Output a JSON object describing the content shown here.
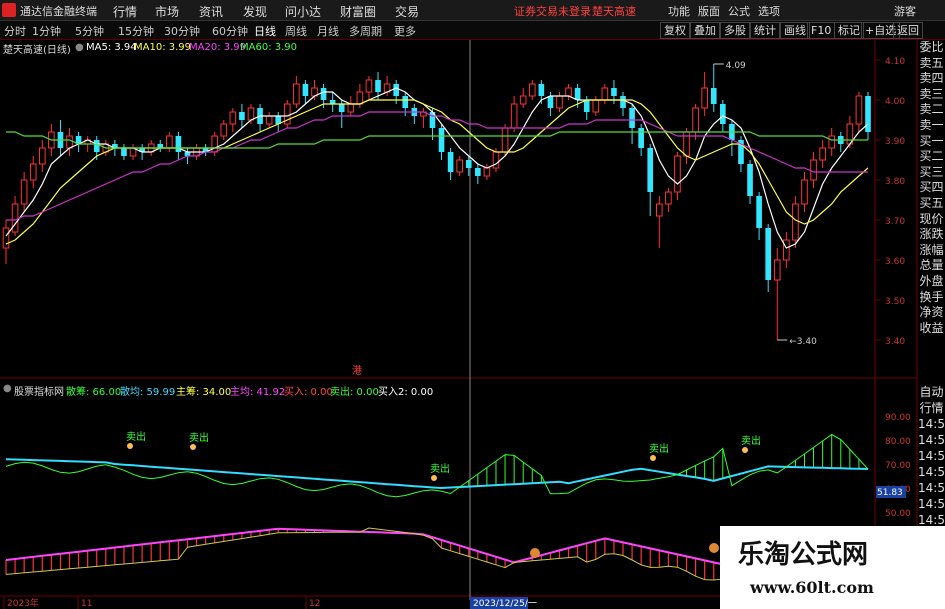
{
  "topbar": {
    "brand": "通达信金融终端",
    "menus": [
      "行情",
      "市场",
      "资讯",
      "发现",
      "问小达",
      "财富圈",
      "交易"
    ],
    "alert": "证券交易未登录",
    "alert2": "楚天高速",
    "right": [
      "功能",
      "版面",
      "公式",
      "选项"
    ],
    "guest": "游客"
  },
  "toolbar": {
    "timeframes": [
      "分时",
      "1分钟",
      "5分钟",
      "15分钟",
      "30分钟",
      "60分钟",
      "日线",
      "周线",
      "月线",
      "多周期",
      "更多"
    ],
    "right": [
      "复权",
      "叠加",
      "多股",
      "统计",
      "画线",
      "F10",
      "标记",
      "+自选",
      "返回"
    ]
  },
  "header": {
    "stock": "楚天高速(日线)",
    "ma5": "MA5: 3.94",
    "ma10": "MA10: 3.99",
    "ma20": "MA20: 3.99",
    "ma60": "MA60: 3.90"
  },
  "indicator": {
    "name": "股票指标网",
    "items": [
      {
        "text": "散筹: 66.00",
        "color": "#33ff33"
      },
      {
        "text": "散均: 59.99",
        "color": "#33ddff"
      },
      {
        "text": "主筹: 34.00",
        "color": "#ffff44"
      },
      {
        "text": "主均: 41.92",
        "color": "#ff44ff"
      },
      {
        "text": "买入: 0.00",
        "color": "#ff4444"
      },
      {
        "text": "卖出: 0.00",
        "color": "#33ff33"
      },
      {
        "text": "买入2: 0.00",
        "color": "#ffffff"
      }
    ]
  },
  "side_panel": [
    "委比",
    "卖五",
    "卖四",
    "卖三",
    "卖二",
    "卖一",
    "买一",
    "买二",
    "买三",
    "买四",
    "买五",
    "现价",
    "涨跌",
    "涨幅",
    "总量",
    "外盘",
    "换手",
    "净资",
    "收益"
  ],
  "side_panel2": [
    "自动",
    "行情",
    "14:50",
    "14:50",
    "14:50",
    "14:50",
    "14:50",
    "14:50",
    "14:50",
    "14:50",
    "14:50",
    "14:50",
    "14:50",
    "14:50"
  ],
  "bottom_axis": {
    "labels": [
      "2023年",
      "11",
      "12",
      "2023/12/25/一"
    ]
  },
  "annotations": {
    "sell": "卖出",
    "hk": "港",
    "hi": "4.09",
    "lo": "3.40",
    "cursor_value": "51.83"
  },
  "watermark": {
    "line1": "乐淘公式网",
    "line2": "www.60lt.com"
  },
  "chart_data": [
    {
      "type": "candlestick",
      "title": "楚天高速(日线)",
      "ylim": [
        3.36,
        4.13
      ],
      "y_ticks": [
        "4.10",
        "4.00",
        "3.90",
        "3.80",
        "3.70",
        "3.60",
        "3.50",
        "3.40"
      ],
      "high_label": 4.09,
      "low_label": 3.4,
      "candles": [
        [
          3.63,
          3.68,
          3.59,
          3.7
        ],
        [
          3.67,
          3.74,
          3.66,
          3.76
        ],
        [
          3.74,
          3.8,
          3.72,
          3.82
        ],
        [
          3.8,
          3.84,
          3.78,
          3.86
        ],
        [
          3.84,
          3.88,
          3.82,
          3.9
        ],
        [
          3.88,
          3.92,
          3.86,
          3.94
        ],
        [
          3.92,
          3.88,
          3.86,
          3.95
        ],
        [
          3.88,
          3.91,
          3.86,
          3.93
        ],
        [
          3.91,
          3.89,
          3.87,
          3.92
        ],
        [
          3.89,
          3.9,
          3.87,
          3.91
        ],
        [
          3.9,
          3.87,
          3.85,
          3.91
        ],
        [
          3.87,
          3.89,
          3.86,
          3.9
        ],
        [
          3.89,
          3.88,
          3.86,
          3.9
        ],
        [
          3.88,
          3.86,
          3.85,
          3.89
        ],
        [
          3.86,
          3.88,
          3.85,
          3.89
        ],
        [
          3.88,
          3.87,
          3.85,
          3.89
        ],
        [
          3.87,
          3.89,
          3.86,
          3.9
        ],
        [
          3.89,
          3.88,
          3.87,
          3.9
        ],
        [
          3.88,
          3.91,
          3.87,
          3.92
        ],
        [
          3.91,
          3.87,
          3.85,
          3.92
        ],
        [
          3.87,
          3.86,
          3.84,
          3.88
        ],
        [
          3.86,
          3.88,
          3.85,
          3.89
        ],
        [
          3.88,
          3.87,
          3.86,
          3.89
        ],
        [
          3.87,
          3.91,
          3.86,
          3.92
        ],
        [
          3.91,
          3.94,
          3.9,
          3.95
        ],
        [
          3.94,
          3.97,
          3.92,
          3.98
        ],
        [
          3.97,
          3.95,
          3.93,
          3.99
        ],
        [
          3.95,
          3.98,
          3.94,
          3.99
        ],
        [
          3.98,
          3.94,
          3.92,
          3.99
        ],
        [
          3.94,
          3.96,
          3.93,
          3.97
        ],
        [
          3.96,
          3.94,
          3.92,
          3.97
        ],
        [
          3.94,
          3.99,
          3.93,
          4.0
        ],
        [
          3.99,
          4.04,
          3.98,
          4.06
        ],
        [
          4.04,
          4.01,
          3.99,
          4.05
        ],
        [
          4.01,
          4.03,
          4.0,
          4.05
        ],
        [
          4.03,
          4.0,
          3.98,
          4.04
        ],
        [
          4.0,
          3.99,
          3.97,
          4.02
        ],
        [
          3.99,
          3.97,
          3.93,
          4.0
        ],
        [
          3.97,
          3.99,
          3.96,
          4.01
        ],
        [
          3.99,
          4.02,
          3.98,
          4.04
        ],
        [
          4.02,
          4.05,
          4.0,
          4.06
        ],
        [
          4.05,
          4.02,
          4.0,
          4.07
        ],
        [
          4.02,
          4.04,
          4.01,
          4.06
        ],
        [
          4.04,
          4.01,
          3.99,
          4.05
        ],
        [
          4.01,
          3.98,
          3.96,
          4.02
        ],
        [
          3.98,
          3.96,
          3.94,
          3.99
        ],
        [
          3.96,
          3.97,
          3.93,
          3.98
        ],
        [
          3.97,
          3.93,
          3.9,
          3.98
        ],
        [
          3.93,
          3.87,
          3.85,
          3.94
        ],
        [
          3.87,
          3.82,
          3.8,
          3.88
        ],
        [
          3.82,
          3.85,
          3.81,
          3.86
        ],
        [
          3.85,
          3.83,
          3.81,
          3.86
        ],
        [
          3.83,
          3.81,
          3.79,
          3.84
        ],
        [
          3.81,
          3.83,
          3.8,
          3.84
        ],
        [
          3.83,
          3.87,
          3.82,
          3.88
        ],
        [
          3.87,
          3.93,
          3.86,
          3.94
        ],
        [
          3.93,
          3.99,
          3.92,
          4.01
        ],
        [
          3.99,
          4.01,
          3.98,
          4.03
        ],
        [
          4.01,
          4.04,
          4.0,
          4.05
        ],
        [
          4.04,
          4.01,
          3.99,
          4.05
        ],
        [
          4.01,
          3.98,
          3.96,
          4.02
        ],
        [
          3.98,
          4.01,
          3.97,
          4.02
        ],
        [
          4.01,
          4.03,
          4.0,
          4.04
        ],
        [
          4.03,
          4.0,
          3.98,
          4.04
        ],
        [
          4.0,
          3.97,
          3.95,
          4.01
        ],
        [
          3.97,
          4.0,
          3.96,
          4.01
        ],
        [
          4.0,
          4.03,
          3.99,
          4.04
        ],
        [
          4.03,
          4.01,
          3.99,
          4.05
        ],
        [
          4.01,
          3.98,
          3.96,
          4.02
        ],
        [
          3.98,
          3.93,
          3.89,
          3.99
        ],
        [
          3.93,
          3.88,
          3.86,
          3.94
        ],
        [
          3.88,
          3.77,
          3.71,
          3.89
        ],
        [
          3.71,
          3.74,
          3.63,
          3.76
        ],
        [
          3.74,
          3.77,
          3.72,
          3.78
        ],
        [
          3.77,
          3.86,
          3.75,
          3.87
        ],
        [
          3.86,
          3.92,
          3.84,
          3.93
        ],
        [
          3.92,
          3.98,
          3.9,
          3.99
        ],
        [
          3.98,
          4.03,
          3.96,
          4.07
        ],
        [
          4.03,
          3.99,
          3.97,
          4.09
        ],
        [
          3.99,
          3.94,
          3.92,
          4.0
        ],
        [
          3.94,
          3.9,
          3.86,
          3.95
        ],
        [
          3.9,
          3.84,
          3.82,
          3.91
        ],
        [
          3.84,
          3.76,
          3.74,
          3.85
        ],
        [
          3.76,
          3.68,
          3.65,
          3.77
        ],
        [
          3.68,
          3.55,
          3.52,
          3.69
        ],
        [
          3.55,
          3.6,
          3.4,
          3.63
        ],
        [
          3.6,
          3.65,
          3.58,
          3.67
        ],
        [
          3.65,
          3.74,
          3.63,
          3.76
        ],
        [
          3.74,
          3.8,
          3.72,
          3.82
        ],
        [
          3.8,
          3.85,
          3.78,
          3.87
        ],
        [
          3.85,
          3.88,
          3.83,
          3.9
        ],
        [
          3.88,
          3.91,
          3.86,
          3.93
        ],
        [
          3.91,
          3.89,
          3.87,
          3.92
        ],
        [
          3.89,
          3.94,
          3.88,
          3.96
        ],
        [
          3.94,
          4.01,
          3.92,
          4.02
        ],
        [
          4.01,
          3.92,
          3.9,
          4.02
        ]
      ],
      "ma5": [
        3.66,
        3.69,
        3.72,
        3.75,
        3.79,
        3.84,
        3.86,
        3.88,
        3.89,
        3.9,
        3.89,
        3.89,
        3.88,
        3.88,
        3.88,
        3.87,
        3.87,
        3.88,
        3.88,
        3.88,
        3.87,
        3.87,
        3.87,
        3.88,
        3.89,
        3.91,
        3.93,
        3.95,
        3.96,
        3.96,
        3.96,
        3.96,
        3.97,
        3.99,
        4.01,
        4.02,
        4.02,
        4.0,
        3.99,
        3.99,
        4.0,
        4.01,
        4.02,
        4.03,
        4.02,
        4.0,
        3.99,
        3.97,
        3.94,
        3.91,
        3.88,
        3.86,
        3.84,
        3.83,
        3.84,
        3.86,
        3.89,
        3.93,
        3.97,
        4.0,
        4.01,
        4.01,
        4.01,
        4.0,
        4.0,
        4.0,
        4.0,
        4.0,
        4.0,
        3.99,
        3.96,
        3.91,
        3.85,
        3.81,
        3.79,
        3.81,
        3.85,
        3.91,
        3.94,
        3.96,
        3.95,
        3.93,
        3.88,
        3.82,
        3.74,
        3.67,
        3.63,
        3.64,
        3.67,
        3.73,
        3.79,
        3.83,
        3.86,
        3.89,
        3.92,
        3.94
      ],
      "ma10": [
        3.64,
        3.65,
        3.67,
        3.69,
        3.72,
        3.75,
        3.78,
        3.8,
        3.82,
        3.84,
        3.86,
        3.87,
        3.88,
        3.88,
        3.88,
        3.88,
        3.88,
        3.88,
        3.88,
        3.88,
        3.88,
        3.88,
        3.88,
        3.88,
        3.88,
        3.89,
        3.9,
        3.91,
        3.92,
        3.93,
        3.94,
        3.95,
        3.96,
        3.97,
        3.98,
        3.99,
        3.99,
        3.99,
        3.99,
        3.99,
        4.0,
        4.0,
        4.0,
        4.0,
        4.0,
        4.0,
        3.99,
        3.98,
        3.97,
        3.95,
        3.94,
        3.92,
        3.9,
        3.88,
        3.87,
        3.87,
        3.87,
        3.88,
        3.9,
        3.92,
        3.94,
        3.96,
        3.98,
        3.99,
        4.0,
        4.0,
        4.0,
        4.0,
        4.0,
        4.0,
        3.99,
        3.97,
        3.94,
        3.91,
        3.88,
        3.86,
        3.85,
        3.86,
        3.87,
        3.88,
        3.89,
        3.89,
        3.87,
        3.84,
        3.8,
        3.76,
        3.72,
        3.7,
        3.69,
        3.7,
        3.72,
        3.74,
        3.77,
        3.79,
        3.81,
        3.83
      ],
      "ma20": [
        3.7,
        3.7,
        3.71,
        3.71,
        3.72,
        3.73,
        3.74,
        3.75,
        3.76,
        3.77,
        3.78,
        3.79,
        3.8,
        3.81,
        3.82,
        3.82,
        3.83,
        3.84,
        3.84,
        3.85,
        3.86,
        3.86,
        3.87,
        3.87,
        3.88,
        3.88,
        3.89,
        3.9,
        3.9,
        3.91,
        3.92,
        3.93,
        3.93,
        3.94,
        3.95,
        3.95,
        3.96,
        3.96,
        3.96,
        3.96,
        3.97,
        3.97,
        3.97,
        3.97,
        3.97,
        3.97,
        3.97,
        3.96,
        3.96,
        3.95,
        3.95,
        3.94,
        3.94,
        3.93,
        3.93,
        3.93,
        3.93,
        3.93,
        3.93,
        3.93,
        3.93,
        3.93,
        3.94,
        3.94,
        3.94,
        3.95,
        3.95,
        3.95,
        3.95,
        3.95,
        3.95,
        3.94,
        3.93,
        3.92,
        3.91,
        3.91,
        3.91,
        3.91,
        3.91,
        3.91,
        3.9,
        3.89,
        3.88,
        3.87,
        3.86,
        3.85,
        3.84,
        3.83,
        3.83,
        3.82,
        3.82,
        3.82,
        3.82,
        3.82,
        3.82,
        3.82
      ],
      "ma60": [
        3.92,
        3.92,
        3.91,
        3.91,
        3.91,
        3.9,
        3.9,
        3.9,
        3.89,
        3.89,
        3.89,
        3.88,
        3.88,
        3.88,
        3.88,
        3.88,
        3.88,
        3.88,
        3.88,
        3.88,
        3.88,
        3.88,
        3.88,
        3.88,
        3.88,
        3.88,
        3.88,
        3.88,
        3.88,
        3.88,
        3.89,
        3.89,
        3.89,
        3.89,
        3.89,
        3.9,
        3.9,
        3.9,
        3.9,
        3.9,
        3.91,
        3.91,
        3.91,
        3.91,
        3.91,
        3.91,
        3.91,
        3.91,
        3.91,
        3.91,
        3.91,
        3.91,
        3.91,
        3.91,
        3.91,
        3.91,
        3.91,
        3.91,
        3.91,
        3.91,
        3.91,
        3.92,
        3.92,
        3.92,
        3.92,
        3.92,
        3.92,
        3.92,
        3.92,
        3.92,
        3.92,
        3.92,
        3.92,
        3.92,
        3.92,
        3.92,
        3.92,
        3.92,
        3.92,
        3.92,
        3.92,
        3.92,
        3.92,
        3.91,
        3.91,
        3.91,
        3.91,
        3.91,
        3.91,
        3.91,
        3.91,
        3.9,
        3.9,
        3.9,
        3.9,
        3.9
      ]
    },
    {
      "type": "line",
      "title": "股票指标网",
      "ylim": [
        50,
        100
      ],
      "y_ticks": [
        "90.00",
        "80.00",
        "70.00",
        "60.00",
        "50.00"
      ],
      "series": [
        {
          "name": "散筹",
          "color": "#33ff33"
        },
        {
          "name": "散均",
          "color": "#33ddff"
        },
        {
          "name": "主筹",
          "color": "#ffff44"
        },
        {
          "name": "主均",
          "color": "#ff44ff"
        }
      ]
    }
  ]
}
